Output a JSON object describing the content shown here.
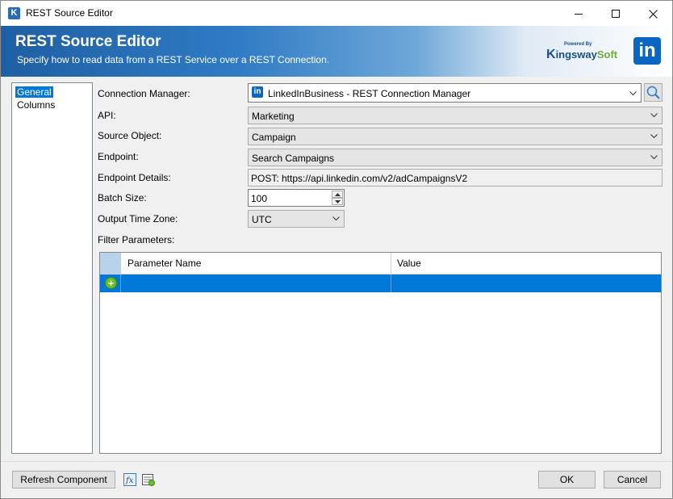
{
  "window": {
    "title": "REST Source Editor"
  },
  "banner": {
    "title": "REST Source Editor",
    "subtitle": "Specify how to read data from a REST Service over a REST Connection.",
    "vendor_powered_by": "Powered By",
    "vendor_name_k": "K",
    "vendor_name_ingsway": "ingsway",
    "vendor_name_soft": "Soft",
    "service_logo_text": "in"
  },
  "nav": {
    "items": [
      {
        "label": "General",
        "selected": true
      },
      {
        "label": "Columns",
        "selected": false
      }
    ]
  },
  "form": {
    "connection_manager": {
      "label": "Connection Manager:",
      "value": "LinkedInBusiness - REST Connection Manager"
    },
    "api": {
      "label": "API:",
      "value": "Marketing"
    },
    "source_object": {
      "label": "Source Object:",
      "value": "Campaign"
    },
    "endpoint": {
      "label": "Endpoint:",
      "value": "Search Campaigns"
    },
    "endpoint_details": {
      "label": "Endpoint Details:",
      "value": "POST: https://api.linkedin.com/v2/adCampaignsV2"
    },
    "batch_size": {
      "label": "Batch Size:",
      "value": "100"
    },
    "output_time_zone": {
      "label": "Output Time Zone:",
      "value": "UTC"
    },
    "filter_parameters": {
      "label": "Filter Parameters:"
    }
  },
  "grid": {
    "columns": [
      "Parameter Name",
      "Value"
    ],
    "rows": [
      {
        "parameter_name": "",
        "value": ""
      }
    ]
  },
  "footer": {
    "refresh_label": "Refresh Component",
    "fx_label": "fx",
    "ok_label": "OK",
    "cancel_label": "Cancel"
  },
  "colors": {
    "selection": "#0078d7",
    "linkedin": "#0a66c2",
    "kingsway_blue": "#1a4e8a",
    "kingsway_green": "#6cae3d"
  }
}
